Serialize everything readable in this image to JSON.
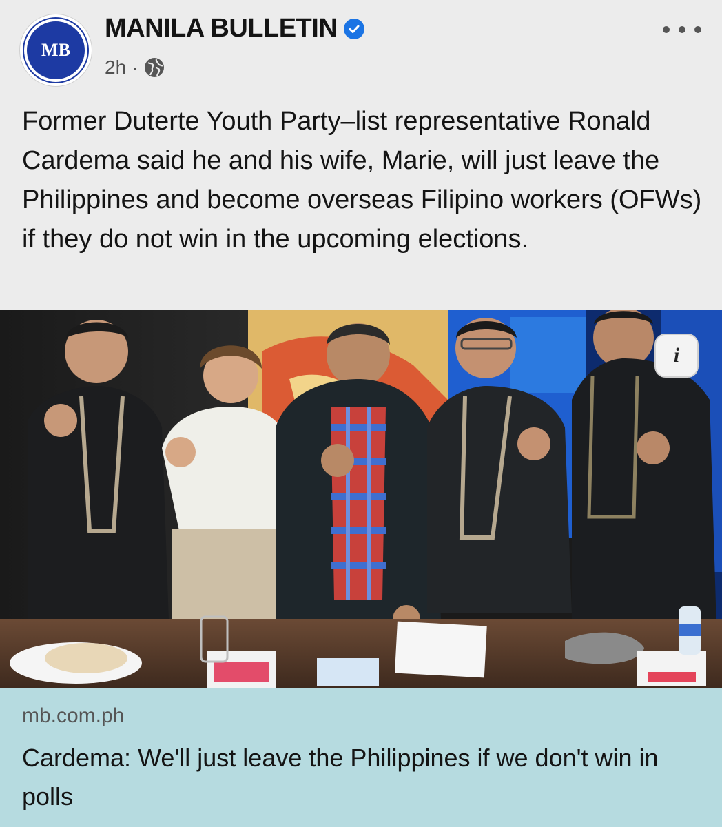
{
  "post": {
    "page_name": "MANILA BULLETIN",
    "avatar_text": "MB",
    "time": "2h",
    "separator": "·",
    "privacy_icon": "globe-icon",
    "verified_icon": "verified-badge-icon",
    "more_icon": "more-options-icon",
    "text": "Former Duterte Youth Party–list representative Ronald Cardema said he and his wife, Marie, will just leave the Philippines and become overseas Filipino workers (OFWs) if they do not win in the upcoming elections."
  },
  "photo": {
    "info_label": "i"
  },
  "link": {
    "domain": "mb.com.ph",
    "title": "Cardema: We'll just leave the Philippines if we don't win in polls"
  },
  "colors": {
    "brand_blue": "#1d3aa3",
    "verified_blue": "#1b74e4",
    "link_card_bg": "#b6dbe0",
    "page_bg": "#ececec"
  }
}
